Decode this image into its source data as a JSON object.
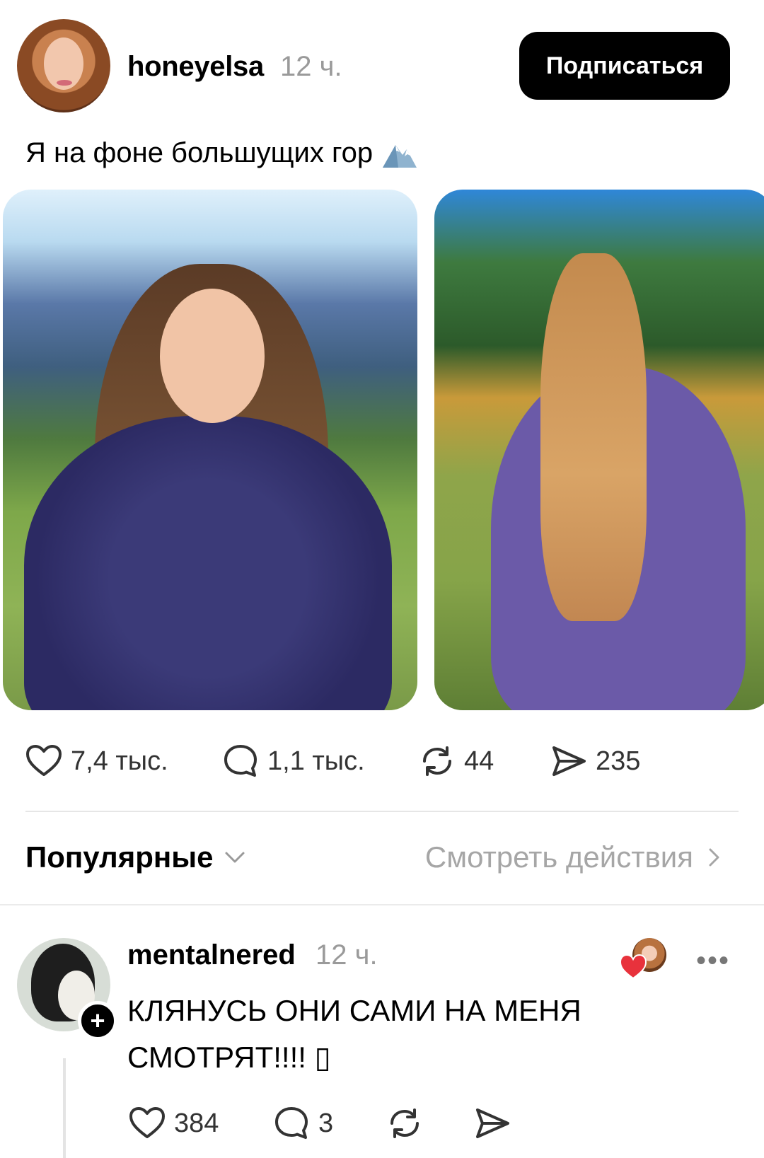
{
  "post": {
    "author": "honeyelsa",
    "time": "12 ч.",
    "follow_label": "Подписаться",
    "caption": "Я на фоне большущих гор",
    "caption_icon": "snow-mountain-icon",
    "stats": {
      "likes": "7,4 тыс.",
      "comments": "1,1 тыс.",
      "reposts": "44",
      "shares": "235"
    }
  },
  "sort": {
    "label": "Популярные",
    "view_actions": "Смотреть действия"
  },
  "comment": {
    "author": "mentalnered",
    "time": "12 ч.",
    "text": "КЛЯНУСЬ ОНИ САМИ НА МЕНЯ СМОТРЯТ!!!! ▯",
    "stats": {
      "likes": "384",
      "replies": "3"
    }
  },
  "colors": {
    "follow_bg": "#000000",
    "muted_text": "#9a9a9a",
    "heart_red": "#e8323c"
  }
}
